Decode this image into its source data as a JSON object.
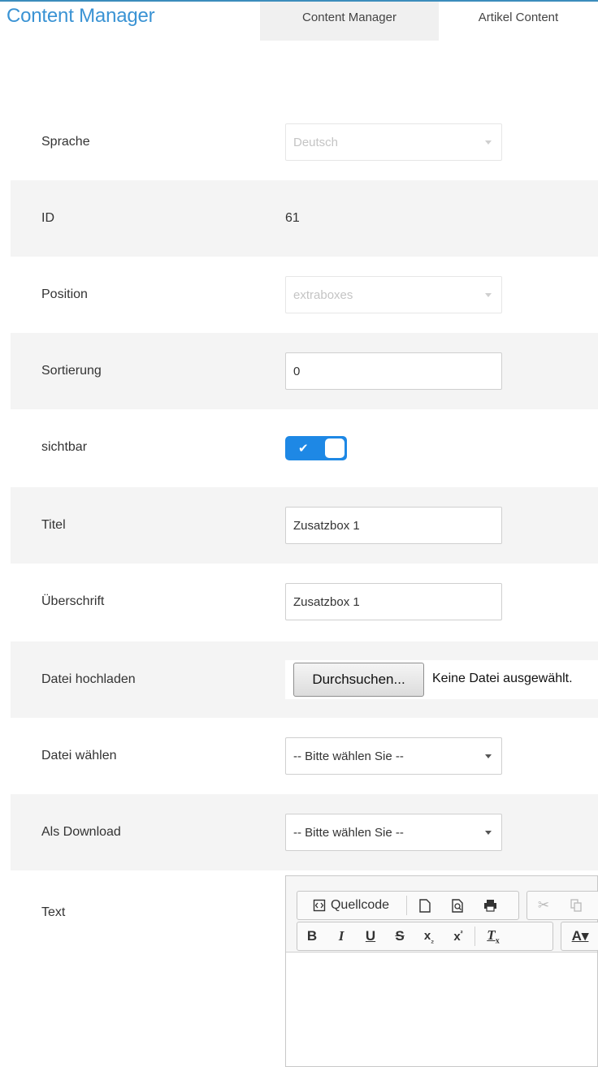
{
  "header": {
    "app_title": "Content Manager",
    "tabs": [
      {
        "label": "Content Manager"
      },
      {
        "label": "Artikel Content"
      }
    ]
  },
  "form": {
    "language": {
      "label": "Sprache",
      "value": "Deutsch"
    },
    "id": {
      "label": "ID",
      "value": "61"
    },
    "position": {
      "label": "Position",
      "value": "extraboxes"
    },
    "sort": {
      "label": "Sortierung",
      "value": "0"
    },
    "visible": {
      "label": "sichtbar",
      "on": true
    },
    "title": {
      "label": "Titel",
      "value": "Zusatzbox 1"
    },
    "heading": {
      "label": "Überschrift",
      "value": "Zusatzbox 1"
    },
    "upload": {
      "label": "Datei hochladen",
      "button": "Durchsuchen...",
      "status": "Keine Datei ausgewählt."
    },
    "file_select": {
      "label": "Datei wählen",
      "value": "-- Bitte wählen Sie --"
    },
    "download": {
      "label": "Als Download",
      "value": "-- Bitte wählen Sie --"
    },
    "text": {
      "label": "Text"
    }
  },
  "editor": {
    "source_label": "Quellcode",
    "colors": {
      "accent": "#1e88e5",
      "brand": "#3a93d4"
    }
  }
}
